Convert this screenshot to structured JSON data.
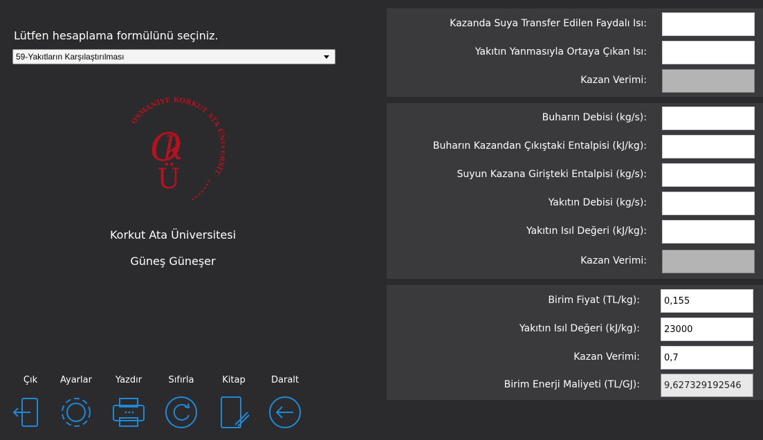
{
  "selector": {
    "prompt": "Lütfen hesaplama formülünü seçiniz.",
    "selected": "59-Yakıtların Karşılaştırılması"
  },
  "logo": {
    "ring_text": "OSMANİYE KORKUT ATA ÜNİVERSİTESİ",
    "monogram": "OKÜ",
    "color": "#b3121f"
  },
  "branding": {
    "university": "Korkut Ata Üniversitesi",
    "author": "Güneş Güneşer"
  },
  "toolbar": [
    {
      "label": "Çık",
      "icon": "exit-icon"
    },
    {
      "label": "Ayarlar",
      "icon": "gear-icon"
    },
    {
      "label": "Yazdır",
      "icon": "printer-icon"
    },
    {
      "label": "Sıfırla",
      "icon": "reset-icon"
    },
    {
      "label": "Kitap",
      "icon": "book-icon"
    },
    {
      "label": "Daralt",
      "icon": "collapse-icon"
    }
  ],
  "panel1": {
    "fields": [
      {
        "label": "Kazanda Suya Transfer Edilen Faydalı Isı:",
        "value": ""
      },
      {
        "label": "Yakıtın Yanmasıyla Ortaya Çıkan Isı:",
        "value": ""
      },
      {
        "label": "Kazan Verimi:",
        "value": ""
      }
    ]
  },
  "panel2": {
    "fields": [
      {
        "label": "Buharın Debisi (kg/s):",
        "value": ""
      },
      {
        "label": "Buharın Kazandan Çıkıştaki Entalpisi (kJ/kg):",
        "value": ""
      },
      {
        "label": "Suyun Kazana Girişteki Entalpisi (kg/s):",
        "value": ""
      },
      {
        "label": "Yakıtın Debisi (kg/s):",
        "value": ""
      },
      {
        "label": "Yakıtın Isıl Değeri (kJ/kg):",
        "value": ""
      },
      {
        "label": "Kazan Verimi:",
        "value": ""
      }
    ]
  },
  "panel3": {
    "fields": [
      {
        "label": "Birim Fiyat (TL/kg):",
        "value": "0,155"
      },
      {
        "label": "Yakıtın Isıl Değeri (kJ/kg):",
        "value": "23000"
      },
      {
        "label": "Kazan Verimi:",
        "value": "0,7"
      },
      {
        "label": "Birim Enerji Maliyeti (TL/GJ):",
        "value": "9,627329192546"
      }
    ]
  },
  "colors": {
    "background": "#2b2b2d",
    "panel": "#3a3a3c",
    "icon": "#1e8ad6",
    "readonly": "#b4b4b4"
  }
}
